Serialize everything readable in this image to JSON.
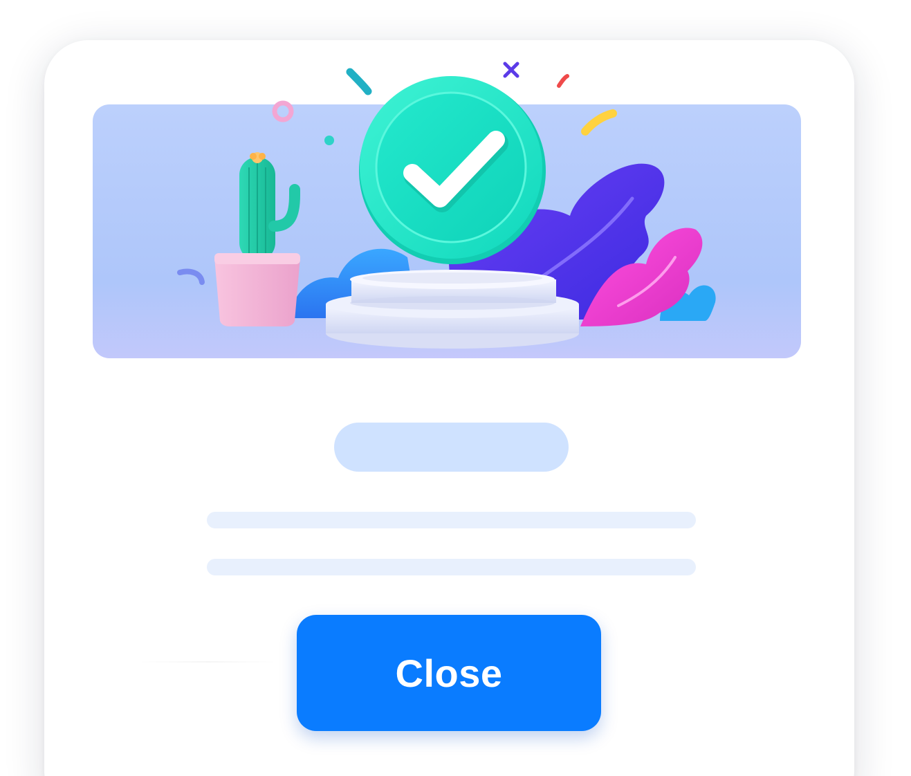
{
  "dialog": {
    "close_button_label": "Close"
  },
  "illustration": {
    "icon": "success-checkmark-icon",
    "colors": {
      "banner_background": "#b7cdfb",
      "check_badge": "#1fe6c7",
      "pedestal": "#e3e7f6",
      "cactus": "#22c9a8",
      "pot": "#f6b7d6",
      "leaf_purple": "#5a35f0",
      "leaf_pink": "#f03fd6",
      "leaf_blue": "#28a9f0"
    }
  },
  "placeholders": {
    "title": "title-skeleton",
    "lines": 2
  },
  "colors": {
    "primary": "#0a7cff",
    "skeleton_title": "#cfe2ff",
    "skeleton_line": "#e8f0fd"
  }
}
